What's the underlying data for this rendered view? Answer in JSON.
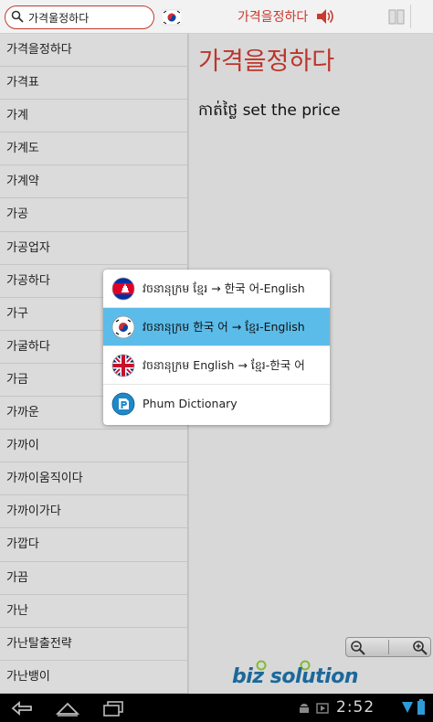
{
  "search": {
    "value": "가격울정하다"
  },
  "header": {
    "word": "가격을정하다"
  },
  "word_list": [
    "가격을정하다",
    "가격표",
    "가계",
    "가계도",
    "가계약",
    "가공",
    "가공업자",
    "가공하다",
    "가구",
    "가굴하다",
    "가금",
    "가까운",
    "가까이",
    "가까이움직이다",
    "가까이가다",
    "가깝다",
    "가끔",
    "가난",
    "가난탈출전략",
    "가난뱅이"
  ],
  "entry": {
    "headword": "가격을정하다",
    "meaning": "កាត់ថ្លៃ set the price"
  },
  "dialog": {
    "options": [
      {
        "label": "វចនានុក្រម ខ្មែរ → 한국 어-English",
        "icon": "cambodia-flag-icon",
        "selected": false
      },
      {
        "label": "វចនានុក្រម 한국 어 → ខ្មែរ-English",
        "icon": "korea-flag-icon",
        "selected": true
      },
      {
        "label": "វចនានុក្រម English → ខ្មែរ-한국 어",
        "icon": "uk-flag-icon",
        "selected": false
      },
      {
        "label": "Phum Dictionary",
        "icon": "phum-dictionary-icon",
        "selected": false
      }
    ]
  },
  "logo": {
    "text": "biz solution"
  },
  "status": {
    "time": "2:52"
  },
  "colors": {
    "accent": "#c8392f",
    "selected": "#5bbce9",
    "logo": "#1d6fa5"
  }
}
